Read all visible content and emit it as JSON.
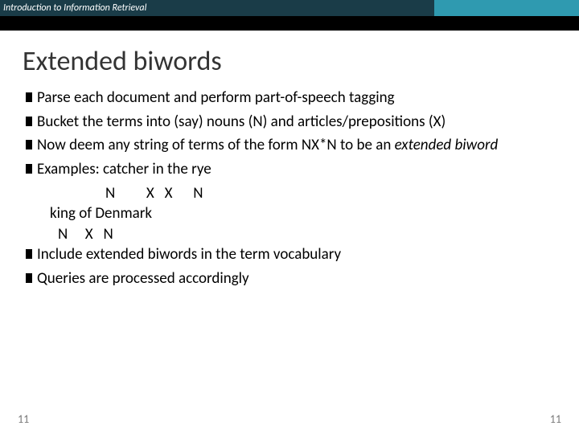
{
  "header": {
    "course": "Introduction to Information Retrieval"
  },
  "title": "Extended biwords",
  "bullets": {
    "b1": "Parse each document and perform part-of-speech tagging",
    "b2": "Bucket the terms into (say) nouns (N) and articles/prepositions (X)",
    "b3_a": "Now deem any string of terms of the form NX*N to be an ",
    "b3_b": "extended biword",
    "b4": "Examples: catcher in  the rye",
    "ex1_tags": "N         X   X      N",
    "ex2": "king of Denmark",
    "ex2_tags": "N     X   N",
    "b5": "Include extended biwords in the term vocabulary",
    "b6": "Queries are processed accordingly"
  },
  "footer": {
    "left": "11",
    "right": "11"
  }
}
